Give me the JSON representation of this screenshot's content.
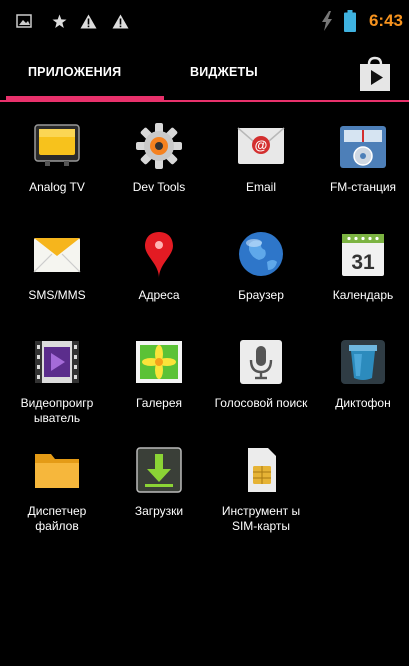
{
  "status_bar": {
    "time": "6:43",
    "icons": [
      "image-notification-icon",
      "star-notification-icon",
      "warning-icon",
      "warning-icon",
      "charging-icon",
      "battery-icon"
    ]
  },
  "tabs": {
    "apps_label": "ПРИЛОЖЕНИЯ",
    "widgets_label": "ВИДЖЕТЫ",
    "active": "apps",
    "store_icon": "play-store-icon"
  },
  "colors": {
    "accent": "#e8316b",
    "time": "#f7931e",
    "background": "#000000"
  },
  "apps": [
    {
      "label": "Analog TV",
      "icon": "tv-icon"
    },
    {
      "label": "Dev Tools",
      "icon": "gear-icon"
    },
    {
      "label": "Email",
      "icon": "email-icon"
    },
    {
      "label": "FM-станция",
      "icon": "radio-icon"
    },
    {
      "label": "SMS/MMS",
      "icon": "envelope-icon"
    },
    {
      "label": "Адреса",
      "icon": "map-pin-icon"
    },
    {
      "label": "Браузер",
      "icon": "globe-icon"
    },
    {
      "label": "Календарь",
      "icon": "calendar-icon",
      "calendar_day": "31"
    },
    {
      "label": "Видеопроигр ыватель",
      "icon": "video-player-icon"
    },
    {
      "label": "Галерея",
      "icon": "gallery-icon"
    },
    {
      "label": "Голосовой поиск",
      "icon": "microphone-icon"
    },
    {
      "label": "Диктофон",
      "icon": "recorder-icon"
    },
    {
      "label": "Диспетчер файлов",
      "icon": "folder-icon"
    },
    {
      "label": "Загрузки",
      "icon": "download-icon"
    },
    {
      "label": "Инструмент ы SIM-карты",
      "icon": "sim-card-icon"
    }
  ]
}
